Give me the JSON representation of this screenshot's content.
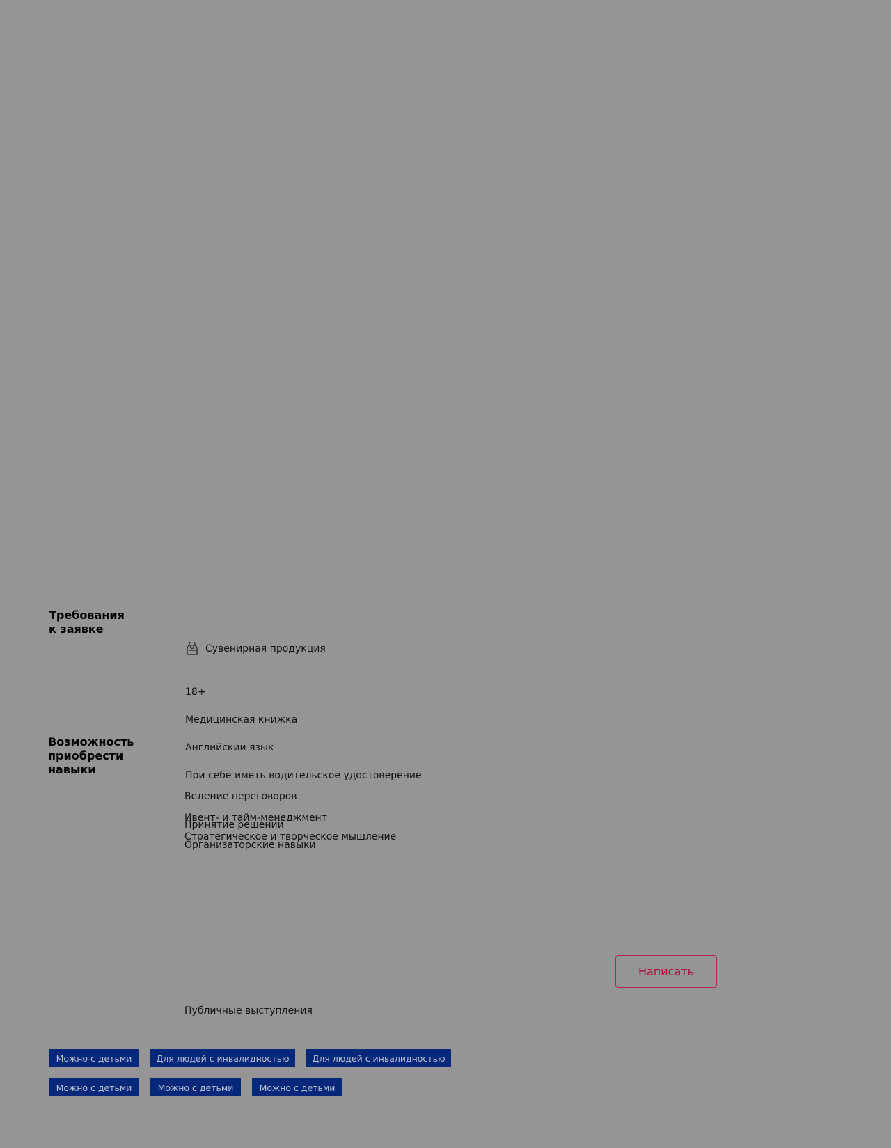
{
  "requirements": {
    "title_line1": "Требования",
    "title_line2": "к заявке",
    "icon_item": {
      "icon": "souvenir-icon",
      "label": "Сувенирная продукция"
    },
    "age": "18+",
    "medical_book": "Медицинская книжка",
    "english": "Английский язык",
    "driver_license": "При себе иметь водительское удостоверение"
  },
  "skills": {
    "title_line1": "Возможность",
    "title_line2": "приобрести",
    "title_line3": "навыки",
    "items": [
      "Ведение переговоров",
      "Ивент- и тайм-менеджмент",
      "Принятие решений",
      "Стратегическое и творческое мышление",
      "Организаторские навыки"
    ],
    "public_speaking": "Публичные выступления"
  },
  "contact": {
    "write_label": "Написать"
  },
  "tags": {
    "row1": [
      "Можно с детьми",
      "Для людей с инвалидностью",
      "Для людей с инвалидностью"
    ],
    "row2": [
      "Можно с детьми",
      "Можно с детьми",
      "Можно с детьми"
    ]
  },
  "colors": {
    "background": "#959595",
    "tag_bg": "#06287a",
    "tag_text": "#b9c0d6",
    "button_accent": "#a5123c"
  }
}
